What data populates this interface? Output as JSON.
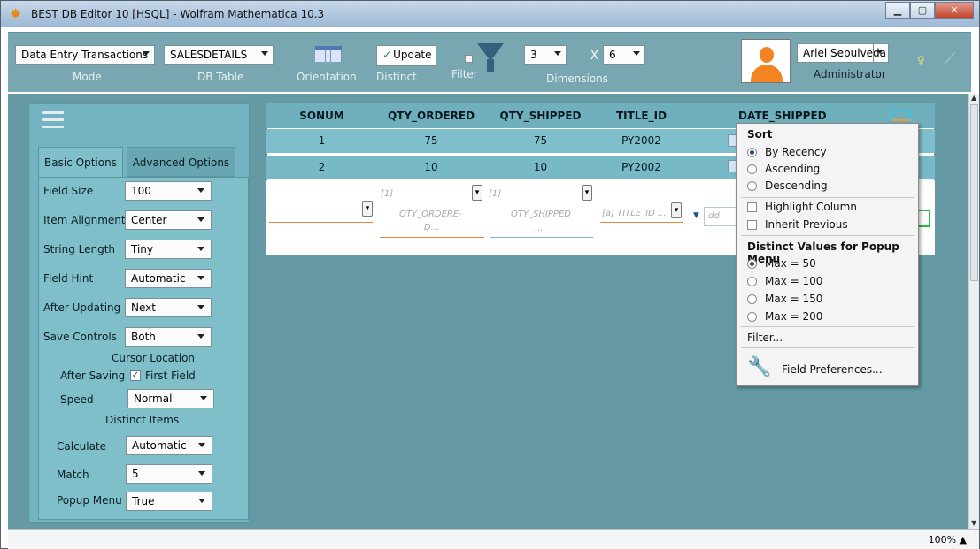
{
  "window": {
    "title": "BEST DB Editor 10 [HSQL] - Wolfram Mathematica 10.3",
    "minimize_icon": "minimize-icon",
    "maximize_icon": "maximize-icon",
    "close_icon": "close-icon"
  },
  "toolbar": {
    "mode_value": "Data Entry Transactions",
    "mode_label": "Mode",
    "table_value": "SALESDETAILS",
    "table_label": "DB Table",
    "orientation_label": "Orientation",
    "update_label": "Update",
    "distinct_label": "Distinct",
    "filter_label": "Filter",
    "rows_value": "3",
    "x_symbol": "X",
    "cols_value": "6",
    "dimensions_label": "Dimensions",
    "user_name": "Ariel Sepulveda",
    "user_role": "Administrator"
  },
  "panel": {
    "tabs": [
      "Basic Options",
      "Advanced Options"
    ],
    "options": [
      {
        "label": "Field Size",
        "value": "100"
      },
      {
        "label": "Item Alignment",
        "value": "Center"
      },
      {
        "label": "String Length",
        "value": "Tiny"
      },
      {
        "label": "Field Hint",
        "value": "Automatic"
      },
      {
        "label": "After Updating",
        "value": "Next"
      },
      {
        "label": "Save Controls",
        "value": "Both"
      }
    ],
    "cursor_location": "Cursor Location",
    "after_saving": "After Saving",
    "first_field": "First Field",
    "speed_label": "Speed",
    "speed_value": "Normal",
    "distinct_items": "Distinct Items",
    "calculate_label": "Calculate",
    "calculate_value": "Automatic",
    "match_label": "Match",
    "match_value": "5",
    "popup_label": "Popup Menu",
    "popup_value": "True"
  },
  "table": {
    "columns": [
      "SONUM",
      "QTY_ORDERED",
      "QTY_SHIPPED",
      "TITLE_ID",
      "DATE_SHIPPED"
    ],
    "rows": [
      [
        "1",
        "75",
        "75",
        "PY2002"
      ],
      [
        "2",
        "10",
        "10",
        "PY2002"
      ]
    ],
    "entry_hints": {
      "qty_ordered_tag": "[1]",
      "qty_ordered": "QTY_ORDERE-",
      "qty_ordered_2": "D...",
      "qty_shipped_tag": "[1]",
      "qty_shipped": "QTY_SHIPPED",
      "qty_shipped_2": "...",
      "title_id": "[a] TITLE_ID ...",
      "date": "dd"
    }
  },
  "popup": {
    "sort_header": "Sort",
    "sort_options": [
      "By Recency",
      "Ascending",
      "Descending"
    ],
    "highlight_column": "Highlight Column",
    "inherit_previous": "Inherit Previous",
    "distinct_header": "Distinct Values for Popup Menu",
    "max_options": [
      "Max = 50",
      "Max = 100",
      "Max = 150",
      "Max = 200"
    ],
    "filter": "Filter...",
    "field_preferences": "Field Preferences..."
  },
  "status": {
    "zoom": "100%"
  }
}
